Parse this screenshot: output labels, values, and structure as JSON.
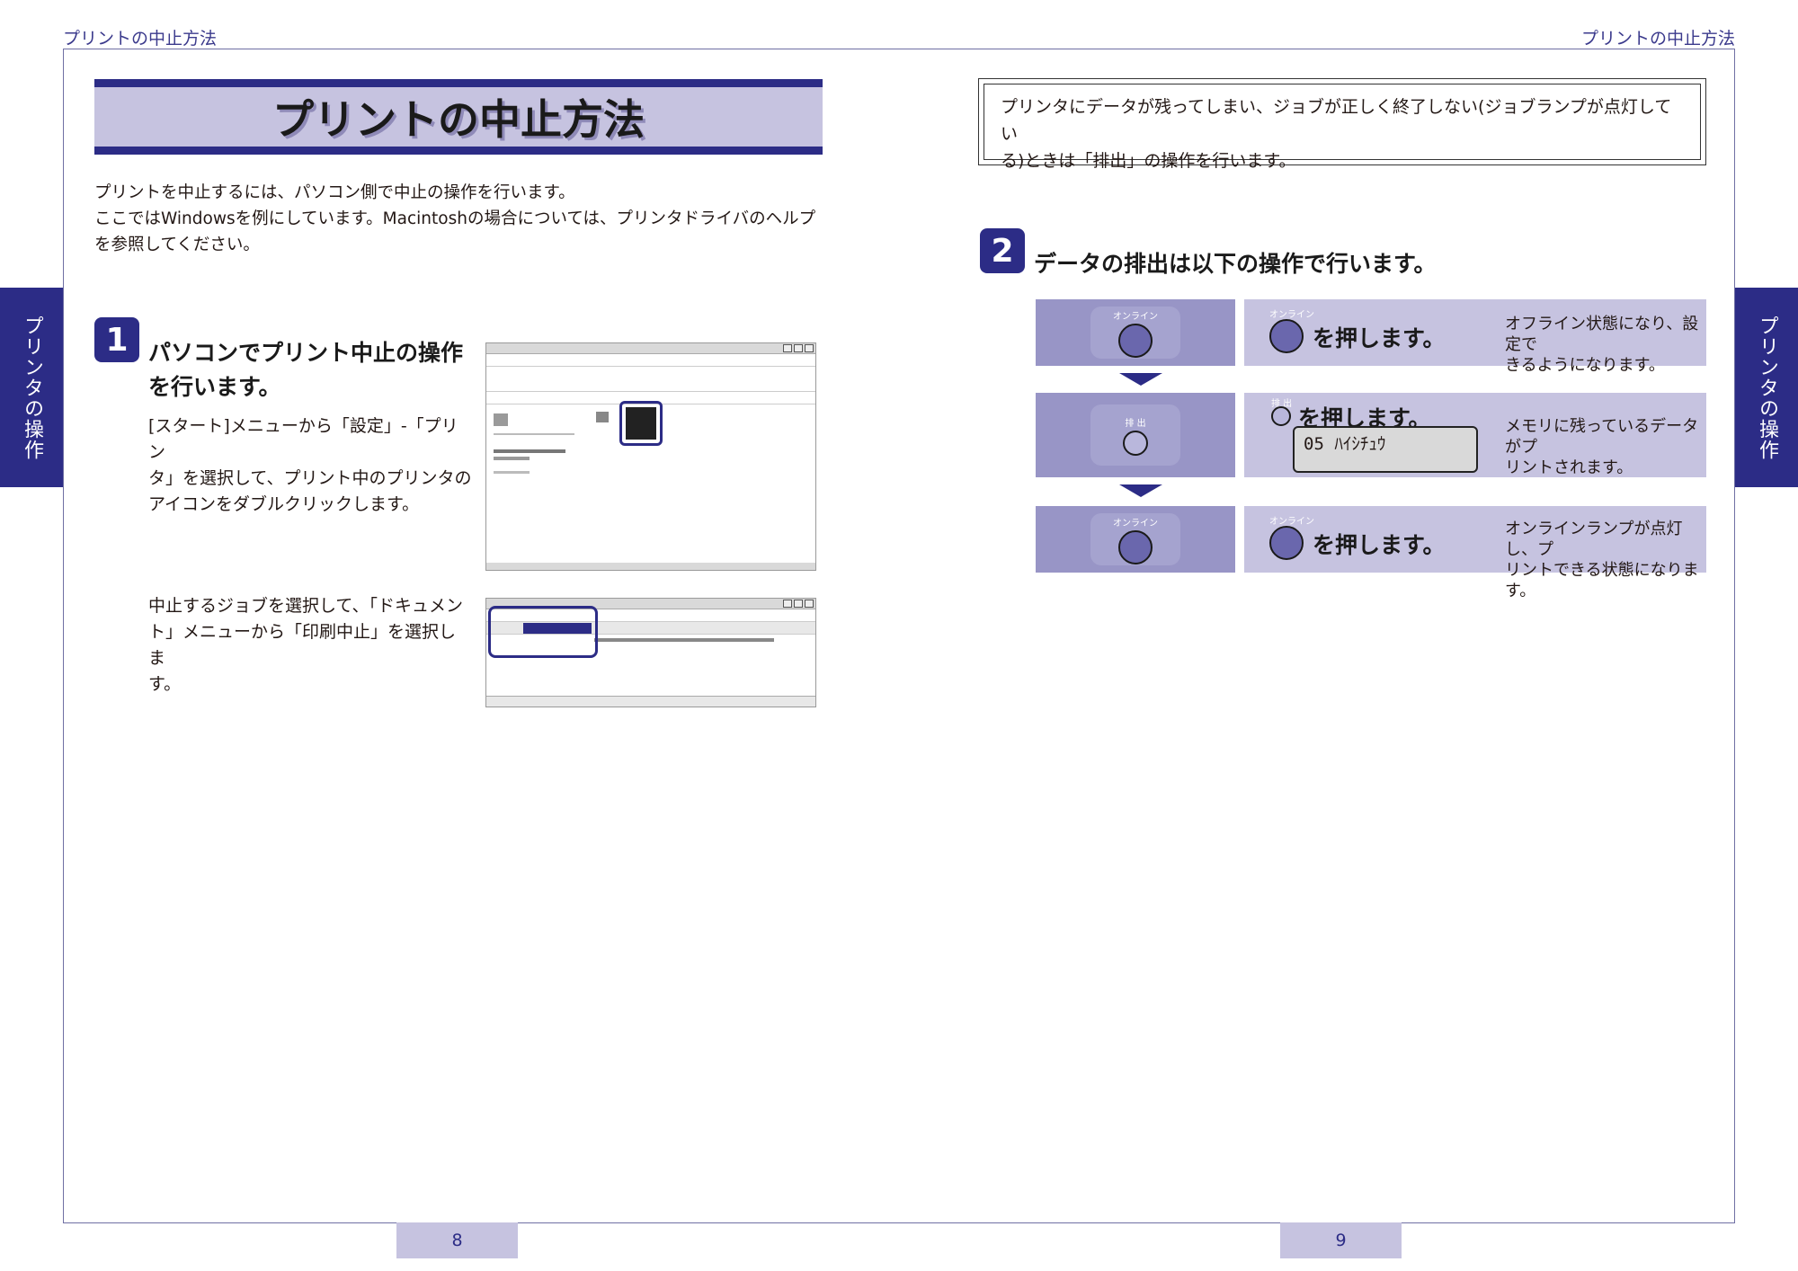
{
  "header": {
    "left_running_title": "プリントの中止方法",
    "right_running_title": "プリントの中止方法"
  },
  "side_tabs": {
    "left": "プリンタの操作",
    "right": "プリンタの操作"
  },
  "title": "プリントの中止方法",
  "intro": {
    "line1": "プリントを中止するには、パソコン側で中止の操作を行います。",
    "line2": "ここではWindowsを例にしています。Macintoshの場合については、プリンタドライバのヘルプ",
    "line3": "を参照してください。"
  },
  "step1": {
    "number": "1",
    "heading_line1": "パソコンでプリント中止の操作",
    "heading_line2": "を行います。",
    "text_a_line1": "[スタート]メニューから「設定」-「プリン",
    "text_a_line2": "タ」を選択して、プリント中のプリンタの",
    "text_a_line3": "アイコンをダブルクリックします。",
    "text_b_line1": "中止するジョブを選択して、「ドキュメン",
    "text_b_line2": "ト」メニューから「印刷中止」を選択しま",
    "text_b_line3": "す。"
  },
  "note": {
    "line1": "プリンタにデータが残ってしまい、ジョブが正しく終了しない(ジョブランプが点灯してい",
    "line2": "る)ときは「排出」の操作を行います。"
  },
  "step2": {
    "number": "2",
    "heading": "データの排出は以下の操作で行います。",
    "rows": [
      {
        "button_caption": "オンライン",
        "small_caption": "オンライン",
        "action": "を押します。",
        "desc_line1": "オフライン状態になり、設定で",
        "desc_line2": "きるようになります。"
      },
      {
        "button_caption": "排 出",
        "small_caption": "排 出",
        "action": "を押します。",
        "lcd": "05  ﾊｲｼﾁｭｳ",
        "desc_line1": "メモリに残っているデータがプ",
        "desc_line2": "リントされます。"
      },
      {
        "button_caption": "オンライン",
        "small_caption": "オンライン",
        "action": "を押します。",
        "desc_line1": "オンラインランプが点灯し、プ",
        "desc_line2": "リントできる状態になります。"
      }
    ]
  },
  "pages": {
    "left": "8",
    "right": "9"
  },
  "colors": {
    "accent": "#2c2c86",
    "panel_light": "#c6c3e0",
    "panel_mid": "#9895c6"
  }
}
